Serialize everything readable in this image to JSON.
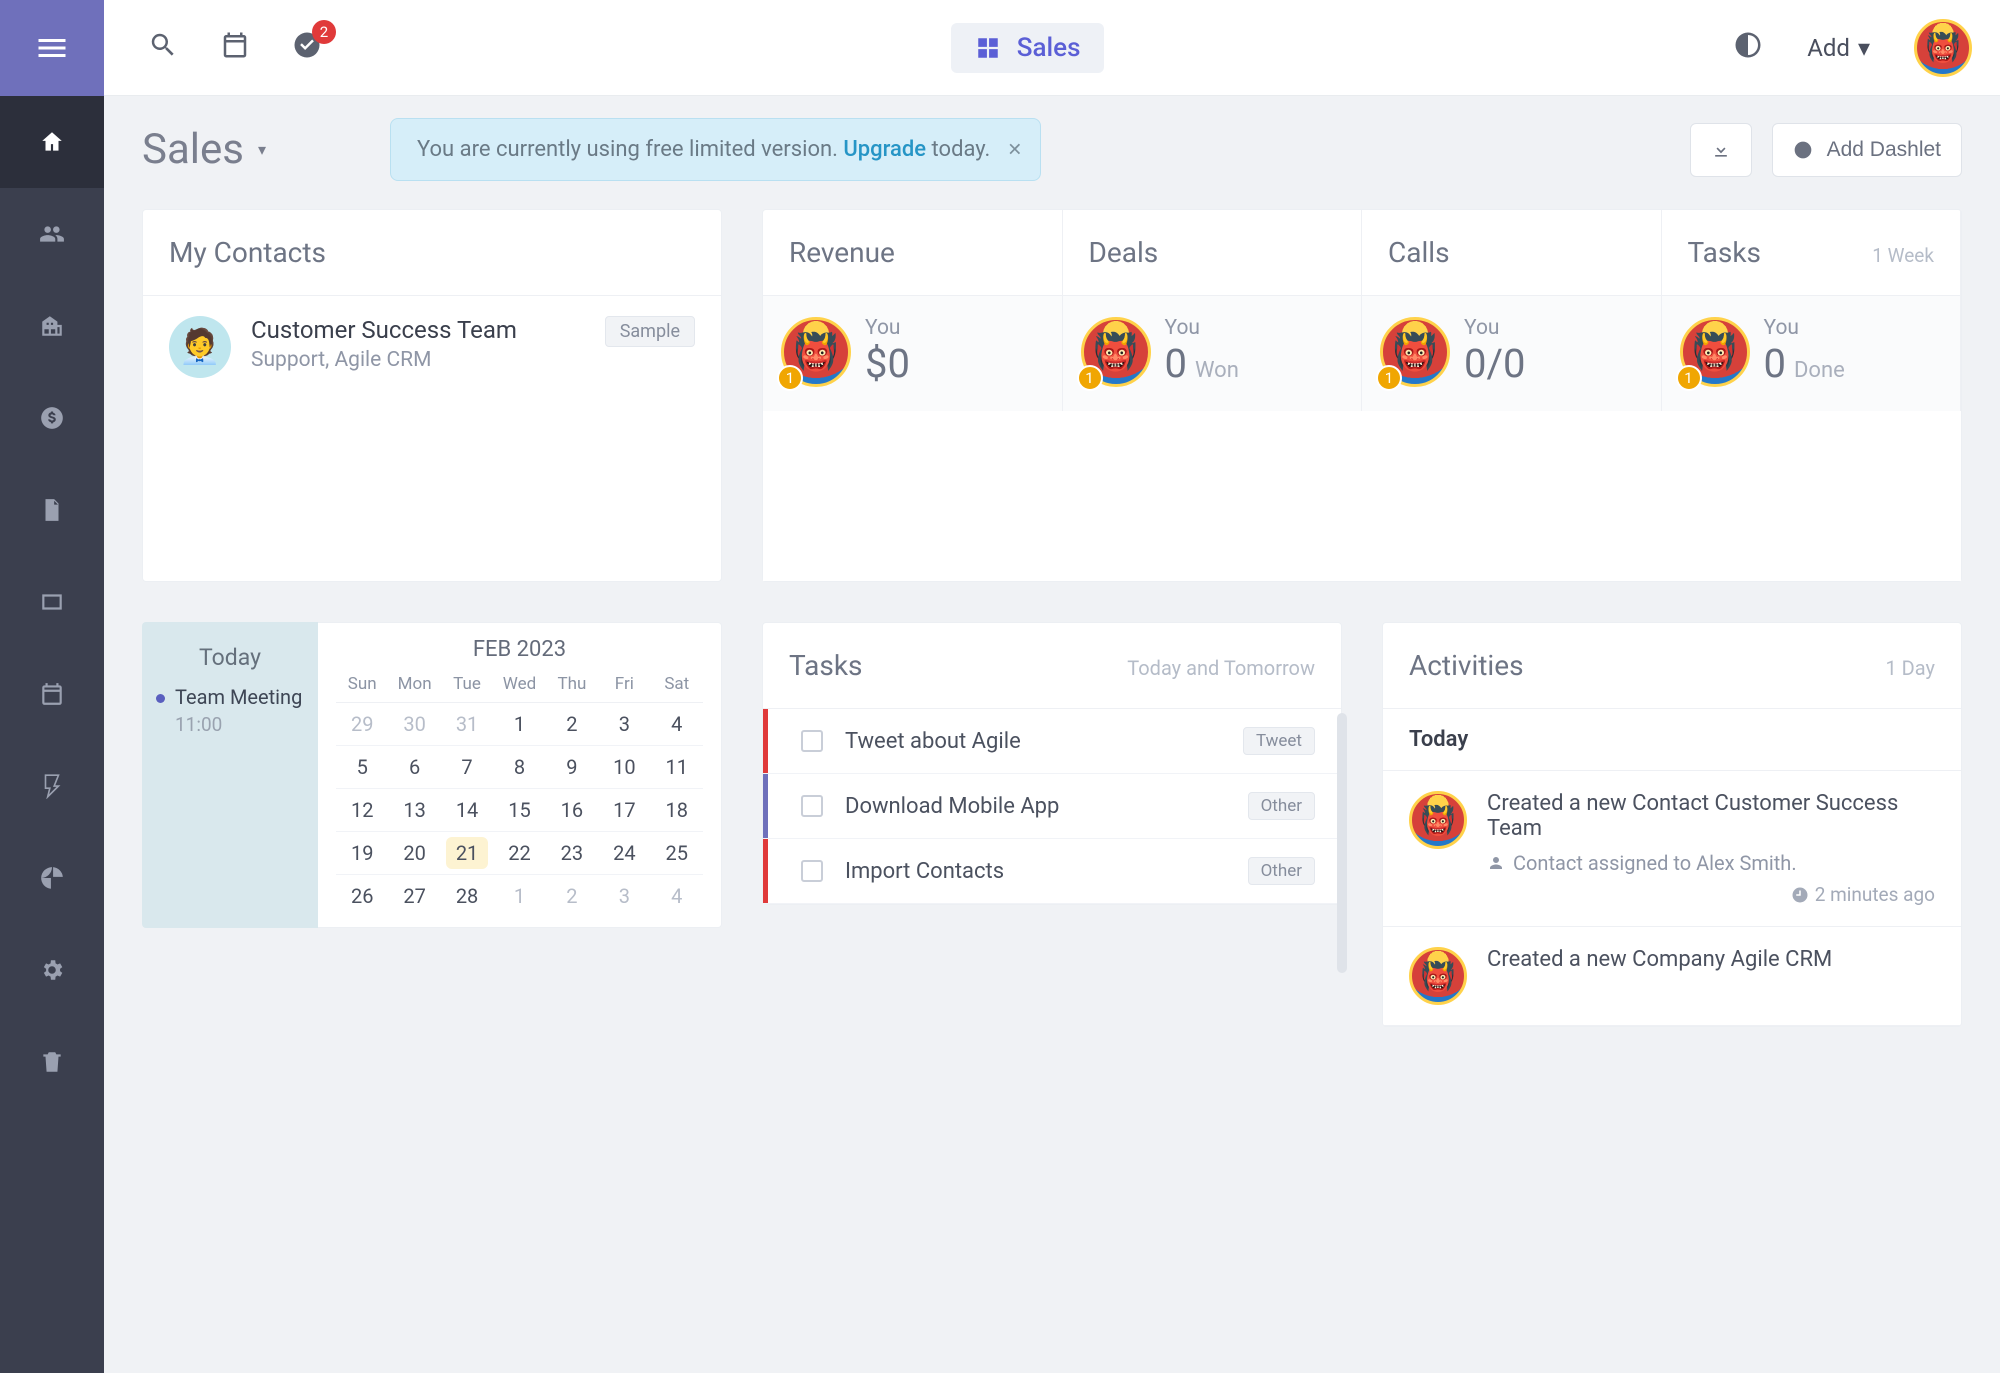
{
  "header": {
    "tab": "Sales",
    "add_label": "Add",
    "tasks_badge": "2"
  },
  "page": {
    "title": "Sales"
  },
  "alert": {
    "prefix": "You are currently using free limited version. ",
    "link": "Upgrade",
    "suffix": " today."
  },
  "buttons": {
    "add_dashlet": "Add Dashlet"
  },
  "contacts": {
    "title": "My Contacts",
    "items": [
      {
        "name": "Customer Success Team",
        "meta": "Support, Agile CRM",
        "tag": "Sample"
      }
    ]
  },
  "stats": {
    "period": "1 Week",
    "you_label": "You",
    "rank": "1",
    "items": [
      {
        "title": "Revenue",
        "value": "$0",
        "unit": ""
      },
      {
        "title": "Deals",
        "value": "0",
        "unit": "Won"
      },
      {
        "title": "Calls",
        "value": "0/0",
        "unit": ""
      },
      {
        "title": "Tasks",
        "value": "0",
        "unit": "Done"
      }
    ]
  },
  "calendar": {
    "today_label": "Today",
    "event": {
      "title": "Team Meeting",
      "time": "11:00"
    },
    "month": "FEB 2023",
    "weekdays": [
      "Sun",
      "Mon",
      "Tue",
      "Wed",
      "Thu",
      "Fri",
      "Sat"
    ],
    "rows": [
      [
        {
          "d": "29",
          "off": true
        },
        {
          "d": "30",
          "off": true
        },
        {
          "d": "31",
          "off": true
        },
        {
          "d": "1"
        },
        {
          "d": "2"
        },
        {
          "d": "3"
        },
        {
          "d": "4"
        }
      ],
      [
        {
          "d": "5"
        },
        {
          "d": "6"
        },
        {
          "d": "7"
        },
        {
          "d": "8"
        },
        {
          "d": "9"
        },
        {
          "d": "10"
        },
        {
          "d": "11"
        }
      ],
      [
        {
          "d": "12"
        },
        {
          "d": "13"
        },
        {
          "d": "14"
        },
        {
          "d": "15"
        },
        {
          "d": "16"
        },
        {
          "d": "17"
        },
        {
          "d": "18"
        }
      ],
      [
        {
          "d": "19"
        },
        {
          "d": "20"
        },
        {
          "d": "21",
          "today": true
        },
        {
          "d": "22"
        },
        {
          "d": "23"
        },
        {
          "d": "24"
        },
        {
          "d": "25"
        }
      ],
      [
        {
          "d": "26"
        },
        {
          "d": "27"
        },
        {
          "d": "28"
        },
        {
          "d": "1",
          "off": true
        },
        {
          "d": "2",
          "off": true
        },
        {
          "d": "3",
          "off": true
        },
        {
          "d": "4",
          "off": true
        }
      ]
    ]
  },
  "tasks": {
    "title": "Tasks",
    "scope": "Today and Tomorrow",
    "items": [
      {
        "label": "Tweet about Agile",
        "tag": "Tweet"
      },
      {
        "label": "Download Mobile App",
        "tag": "Other"
      },
      {
        "label": "Import Contacts",
        "tag": "Other"
      }
    ]
  },
  "activities": {
    "title": "Activities",
    "scope": "1 Day",
    "group": "Today",
    "items": [
      {
        "line1": "Created a new Contact Customer Success Team",
        "line2": "Contact assigned to Alex Smith.",
        "time": "2 minutes ago"
      },
      {
        "line1": "Created a new Company Agile CRM"
      }
    ]
  }
}
